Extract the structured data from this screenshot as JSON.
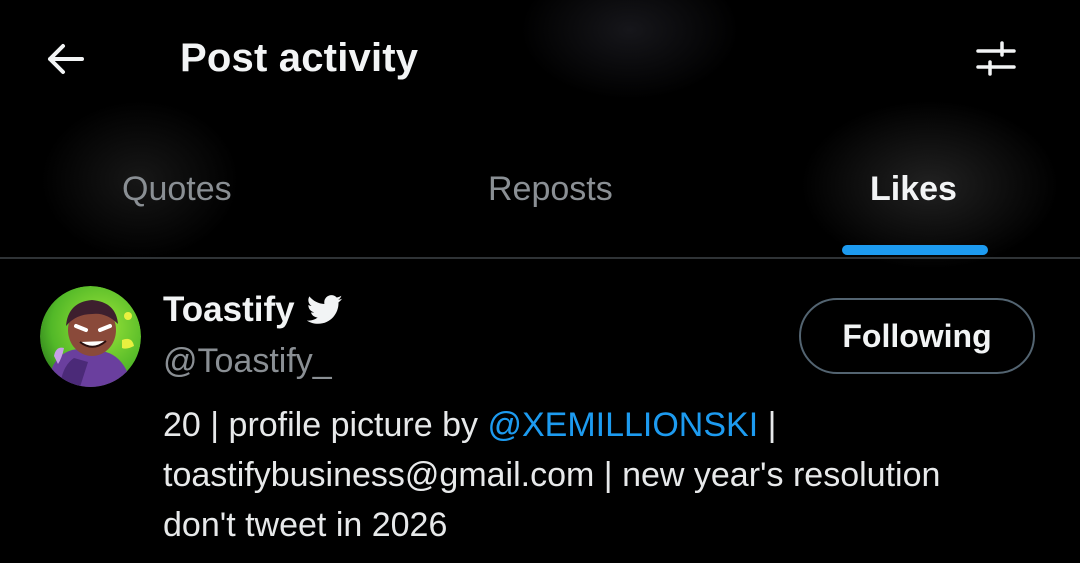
{
  "header": {
    "back_icon": "arrow-left-icon",
    "title": "Post activity",
    "filter_icon": "sliders-icon"
  },
  "tabs": [
    {
      "label": "Quotes",
      "active": false
    },
    {
      "label": "Reposts",
      "active": false
    },
    {
      "label": "Likes",
      "active": true
    }
  ],
  "accent_color": "#1d9bf0",
  "user": {
    "display_name": "Toastify",
    "badge_icon": "twitter-bird-icon",
    "handle": "@Toastify_",
    "follow_label": "Following",
    "bio": {
      "line1_pre": "20 | profile picture by ",
      "line1_mention": "@XEMILLIONSKI",
      "line1_post": " |",
      "line2": "toastifybusiness@gmail.com | new year's resolution",
      "line3": "don't tweet in 2026"
    }
  }
}
